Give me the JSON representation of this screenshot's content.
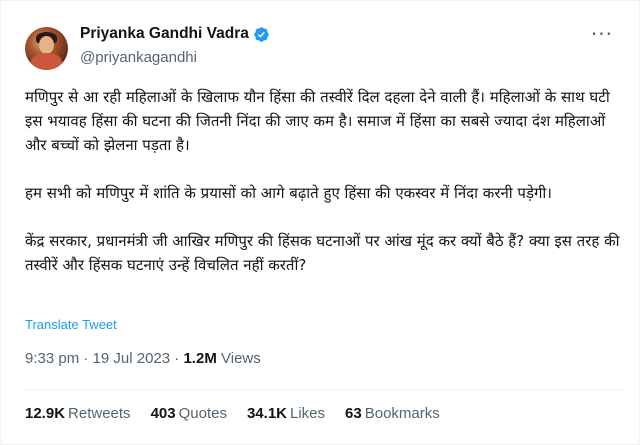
{
  "author": {
    "display_name": "Priyanka Gandhi Vadra",
    "handle": "@priyankagandhi",
    "verified_color": "#1d9bf0",
    "avatar_icon": "profile-photo"
  },
  "more_icon": "ellipsis-icon",
  "tweet": {
    "paragraphs": [
      "मणिपुर से आ रही महिलाओं के खिलाफ यौन हिंसा की तस्वीरें दिल दहला देने वाली हैं। महिलाओं के साथ घटी इस भयावह हिंसा की घटना की जितनी निंदा की जाए कम है। समाज में हिंसा का सबसे ज्यादा दंश महिलाओं और बच्चों को झेलना पड़ता है।",
      "हम सभी को मणिपुर में शांति के प्रयासों को आगे बढ़ाते हुए हिंसा की एकस्वर में निंदा करनी पड़ेगी।",
      "केंद्र सरकार, प्रधानमंत्री जी आखिर मणिपुर की हिंसक घटनाओं पर आंख मूंद कर क्यों बैठे हैं? क्या इस तरह की तस्वीरें और हिंसक घटनाएं उन्हें विचलित नहीं करतीं?"
    ],
    "translate_label": "Translate Tweet"
  },
  "meta": {
    "time": "9:33 pm",
    "separator": " · ",
    "date": "19 Jul 2023",
    "views_count": "1.2M",
    "views_label": "Views"
  },
  "stats": [
    {
      "count": "12.9K",
      "label": "Retweets"
    },
    {
      "count": "403",
      "label": "Quotes"
    },
    {
      "count": "34.1K",
      "label": "Likes"
    },
    {
      "count": "63",
      "label": "Bookmarks"
    }
  ],
  "colors": {
    "text": "#0f1419",
    "secondary": "#536471",
    "accent": "#1d9bf0",
    "divider": "#eff3f4"
  }
}
